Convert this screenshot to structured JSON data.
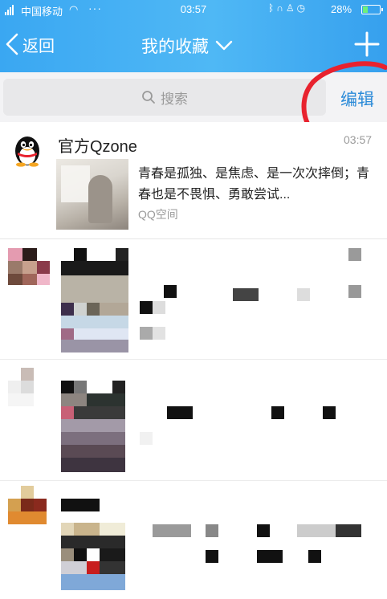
{
  "status_bar": {
    "carrier": "中国移动",
    "time": "03:57",
    "battery": "28%",
    "battery_level": 0.28
  },
  "nav": {
    "back_label": "返回",
    "title": "我的收藏"
  },
  "search": {
    "placeholder": "搜索"
  },
  "edit_label": "编辑",
  "favorites": [
    {
      "author": "官方Qzone",
      "time": "03:57",
      "excerpt": "青春是孤独、是焦虑、是一次次摔倒；青春也是不畏惧、勇敢尝试...",
      "source": "QQ空间"
    }
  ],
  "colors": {
    "nav_blue": "#3aa7f2",
    "edit_blue": "#2a8ad8",
    "annotation_red": "#e8222e"
  }
}
